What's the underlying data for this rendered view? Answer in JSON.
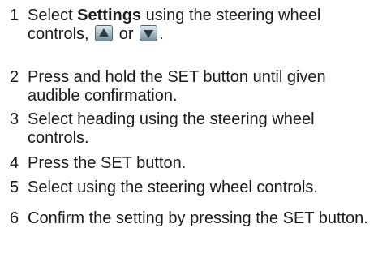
{
  "steps": [
    {
      "number": "1",
      "text_before": "Select ",
      "bold": "Settings",
      "text_after": " using the steering wheel controls, ",
      "connector": " or ",
      "end": ".",
      "icons": [
        "up-arrow-button-icon",
        "down-arrow-button-icon"
      ]
    },
    {
      "number": "2",
      "text": "Press and hold the SET button until given audible confirmation."
    },
    {
      "number": "3",
      "text": "Select heading using the steering wheel controls."
    },
    {
      "number": "4",
      "text": "Press the SET button."
    },
    {
      "number": "5",
      "text": "Select using the steering wheel controls."
    },
    {
      "number": "6",
      "text": "Confirm the setting by pressing the SET button."
    }
  ]
}
